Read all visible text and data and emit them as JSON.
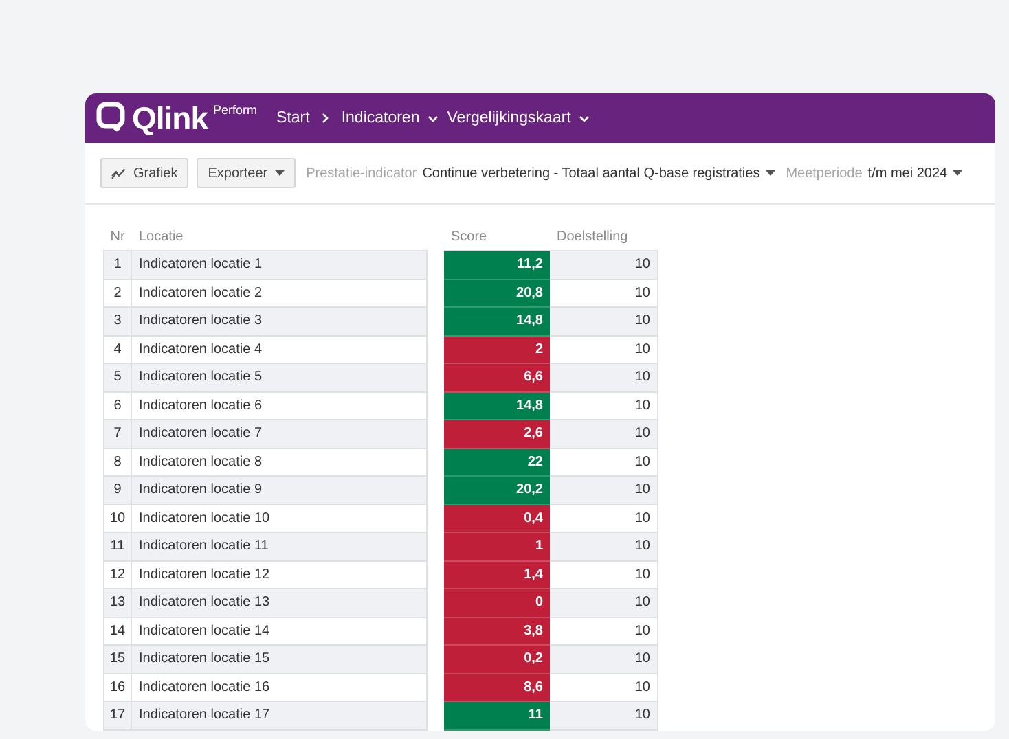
{
  "header": {
    "logo": "Qlink",
    "logo_suffix": "Perform",
    "nav": [
      {
        "label": "Start",
        "kind": "link"
      },
      {
        "label": "Indicatoren",
        "kind": "dropdown"
      },
      {
        "label": "Vergelijkingskaart",
        "kind": "dropdown"
      }
    ]
  },
  "toolbar": {
    "buttons": [
      {
        "label": "Grafiek",
        "kind": "chart"
      },
      {
        "label": "Exporteer",
        "kind": "dropdown"
      }
    ],
    "filters": [
      {
        "label": "Prestatie-indicator",
        "value": "Continue verbetering - Totaal aantal Q-base registraties"
      },
      {
        "label": "Meetperiode",
        "value": "t/m mei 2024"
      }
    ]
  },
  "table": {
    "columns": [
      "Nr",
      "Locatie",
      "Score",
      "Doelstelling"
    ],
    "rows": [
      {
        "nr": "1",
        "location": "Indicatoren locatie 1",
        "score": "11,2",
        "color": "#00804f",
        "target": "10"
      },
      {
        "nr": "2",
        "location": "Indicatoren locatie 2",
        "score": "20,8",
        "color": "#00804f",
        "target": "10"
      },
      {
        "nr": "3",
        "location": "Indicatoren locatie 3",
        "score": "14,8",
        "color": "#00804f",
        "target": "10"
      },
      {
        "nr": "4",
        "location": "Indicatoren locatie 4",
        "score": "2",
        "color": "#c01f3a",
        "target": "10"
      },
      {
        "nr": "5",
        "location": "Indicatoren locatie 5",
        "score": "6,6",
        "color": "#c01f3a",
        "target": "10"
      },
      {
        "nr": "6",
        "location": "Indicatoren locatie 6",
        "score": "14,8",
        "color": "#00804f",
        "target": "10"
      },
      {
        "nr": "7",
        "location": "Indicatoren locatie 7",
        "score": "2,6",
        "color": "#c01f3a",
        "target": "10"
      },
      {
        "nr": "8",
        "location": "Indicatoren locatie 8",
        "score": "22",
        "color": "#00804f",
        "target": "10"
      },
      {
        "nr": "9",
        "location": "Indicatoren locatie 9",
        "score": "20,2",
        "color": "#00804f",
        "target": "10"
      },
      {
        "nr": "10",
        "location": "Indicatoren locatie 10",
        "score": "0,4",
        "color": "#c01f3a",
        "target": "10"
      },
      {
        "nr": "11",
        "location": "Indicatoren locatie 11",
        "score": "1",
        "color": "#c01f3a",
        "target": "10"
      },
      {
        "nr": "12",
        "location": "Indicatoren locatie 12",
        "score": "1,4",
        "color": "#c01f3a",
        "target": "10"
      },
      {
        "nr": "13",
        "location": "Indicatoren locatie 13",
        "score": "0",
        "color": "#c01f3a",
        "target": "10"
      },
      {
        "nr": "14",
        "location": "Indicatoren locatie 14",
        "score": "3,8",
        "color": "#c01f3a",
        "target": "10"
      },
      {
        "nr": "15",
        "location": "Indicatoren locatie 15",
        "score": "0,2",
        "color": "#c01f3a",
        "target": "10"
      },
      {
        "nr": "16",
        "location": "Indicatoren locatie 16",
        "score": "8,6",
        "color": "#c01f3a",
        "target": "10"
      },
      {
        "nr": "17",
        "location": "Indicatoren locatie 17",
        "score": "11",
        "color": "#00804f",
        "target": "10"
      }
    ]
  }
}
